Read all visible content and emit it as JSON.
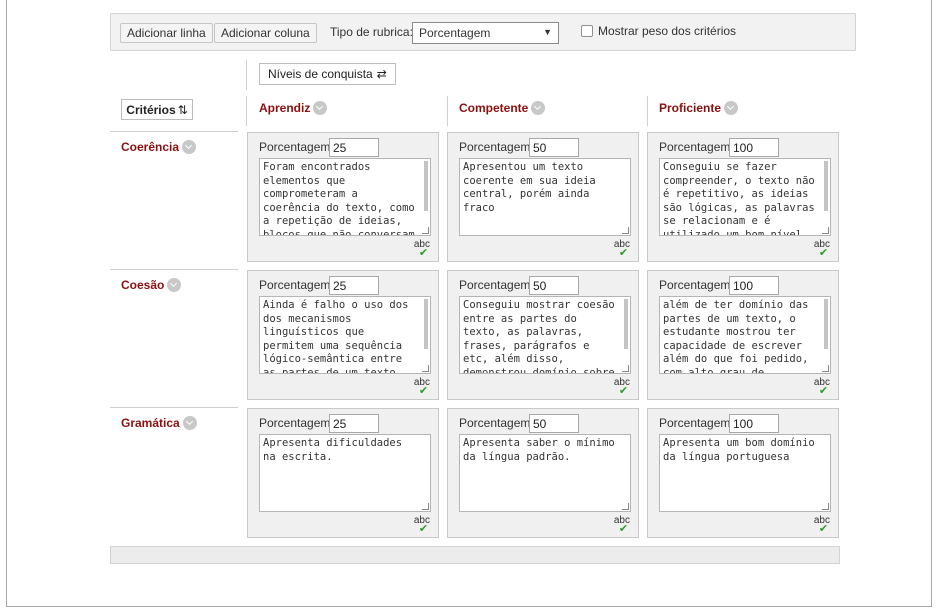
{
  "toolbar": {
    "add_row_label": "Adicionar linha",
    "add_column_label": "Adicionar coluna",
    "rubric_type_label": "Tipo de rubrica:",
    "rubric_type_value": "Porcentagem",
    "show_weight_label": "Mostrar peso dos critérios",
    "show_weight_checked": false
  },
  "levels_button_label": "Níveis de conquista",
  "criteria_button_label": "Critérios",
  "levels": [
    {
      "name": "Aprendiz"
    },
    {
      "name": "Competente"
    },
    {
      "name": "Proficiente"
    }
  ],
  "criteria": [
    {
      "name": "Coerência",
      "cells": [
        {
          "percent_label": "Porcentagem",
          "percent": "25",
          "description": "Foram encontrados elementos que comprometeram a coerência do texto, como a repetição de ideias, blocos que não conversam"
        },
        {
          "percent_label": "Porcentagem",
          "percent": "50",
          "description": "Apresentou um texto coerente em sua ideia central, porém ainda fraco"
        },
        {
          "percent_label": "Porcentagem",
          "percent": "100",
          "description": "Conseguiu se fazer compreender, o texto não é repetitivo, as ideias são lógicas, as palavras se relacionam e é utilizado um bom nível"
        }
      ]
    },
    {
      "name": "Coesão",
      "cells": [
        {
          "percent_label": "Porcentagem",
          "percent": "25",
          "description": "Ainda é falho o uso dos dos mecanismos linguísticos que permitem uma sequência lógico-semântica entre as partes de um texto"
        },
        {
          "percent_label": "Porcentagem",
          "percent": "50",
          "description": "Conseguiu mostrar coesão entre as partes do texto, as palavras, frases, parágrafos e etc, além disso, demonstrou domínio sobre"
        },
        {
          "percent_label": "Porcentagem",
          "percent": "100",
          "description": "além de ter domínio das partes de um texto, o estudante mostrou ter capacidade de escrever além do que foi pedido, com alto grau de"
        }
      ]
    },
    {
      "name": "Gramática",
      "cells": [
        {
          "percent_label": "Porcentagem",
          "percent": "25",
          "description": "Apresenta dificuldades na escrita."
        },
        {
          "percent_label": "Porcentagem",
          "percent": "50",
          "description": "Apresenta saber o mínimo da língua padrão."
        },
        {
          "percent_label": "Porcentagem",
          "percent": "100",
          "description": "Apresenta um bom domínio da língua portuguesa"
        }
      ]
    }
  ],
  "spellcheck_label": "abc"
}
